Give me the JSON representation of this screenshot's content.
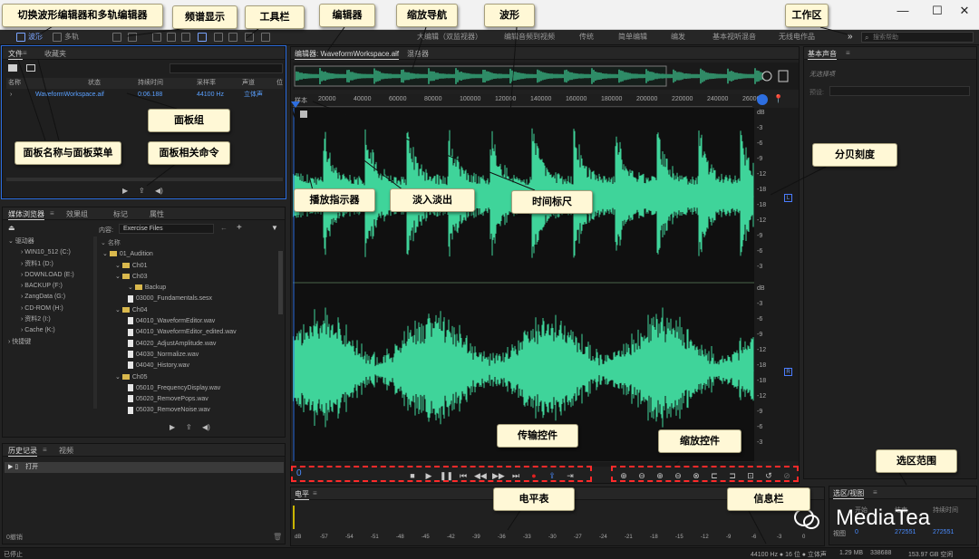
{
  "window": {
    "minimize": "—",
    "maximize": "☐",
    "close": "✕"
  },
  "toolbar": {
    "wave_label": "波形",
    "multitrack_label": "多轨",
    "workspace_items": [
      "大编辑（双监视器）",
      "编辑音频到视频",
      "传统",
      "简单编辑",
      "编发",
      "基本视听混音",
      "无线电作品"
    ],
    "more": "»",
    "search_placeholder": "搜索帮助"
  },
  "files_panel": {
    "tabs": [
      "文件",
      "收藏夹"
    ],
    "columns": [
      "名称",
      "状态",
      "持续时间",
      "采样率",
      "声道",
      "位"
    ],
    "file": {
      "name": "WaveformWorkspace.aif",
      "duration": "0:06.188",
      "rate": "44100 Hz",
      "channels": "立体声"
    }
  },
  "media_panel": {
    "tabs": [
      "媒体浏览器",
      "效果组",
      "标记",
      "属性"
    ],
    "content_label": "内容:",
    "content_value": "Exercise Files",
    "name_header": "名称",
    "drives_header": "驱动器",
    "drives": [
      "WIN10_512 (C:)",
      "资料1 (D:)",
      "DOWNLOAD (E:)",
      "BACKUP (F:)",
      "ZangData (G:)",
      "CD-ROM (H:)",
      "资料2 (I:)",
      "Cache (K:)"
    ],
    "shortcuts": "快捷键",
    "tree": [
      {
        "indent": 0,
        "type": "folder",
        "label": "01_Audition"
      },
      {
        "indent": 1,
        "type": "folder",
        "label": "Ch01"
      },
      {
        "indent": 1,
        "type": "folder",
        "label": "Ch03"
      },
      {
        "indent": 2,
        "type": "folder",
        "label": "Backup"
      },
      {
        "indent": 2,
        "type": "file",
        "label": "03000_Fundamentals.sesx"
      },
      {
        "indent": 1,
        "type": "folder",
        "label": "Ch04"
      },
      {
        "indent": 2,
        "type": "file",
        "label": "04010_WaveformEditor.wav"
      },
      {
        "indent": 2,
        "type": "file",
        "label": "04010_WaveformEditor_edited.wav"
      },
      {
        "indent": 2,
        "type": "file",
        "label": "04020_AdjustAmplitude.wav"
      },
      {
        "indent": 2,
        "type": "file",
        "label": "04030_Normalize.wav"
      },
      {
        "indent": 2,
        "type": "file",
        "label": "04040_History.wav"
      },
      {
        "indent": 1,
        "type": "folder",
        "label": "Ch05"
      },
      {
        "indent": 2,
        "type": "file",
        "label": "05010_FrequencyDisplay.wav"
      },
      {
        "indent": 2,
        "type": "file",
        "label": "05020_RemovePops.wav"
      },
      {
        "indent": 2,
        "type": "file",
        "label": "05030_RemoveNoise.wav"
      }
    ]
  },
  "history_panel": {
    "tabs": [
      "历史记录",
      "视频"
    ],
    "item": "打开",
    "footer": "0撤销"
  },
  "status_left": "已停止",
  "editor": {
    "tabs": [
      "编辑器: WaveformWorkspace.aif",
      "混音器"
    ],
    "ruler_unit": "样本",
    "ruler_labels": [
      "20000",
      "40000",
      "60000",
      "80000",
      "100000",
      "120000",
      "140000",
      "160000",
      "180000",
      "200000",
      "220000",
      "240000",
      "260000"
    ],
    "db_top": [
      "dB",
      "-3",
      "-6",
      "-9",
      "-12",
      "-18",
      "-18",
      "-12",
      "-9",
      "-6",
      "-3"
    ],
    "db_bottom": [
      "dB",
      "-3",
      "-6",
      "-9",
      "-12",
      "-18",
      "-18",
      "-12",
      "-9",
      "-6",
      "-3"
    ],
    "channel_l": "L",
    "channel_r": "R",
    "time_display": "0"
  },
  "essential_sound": {
    "title": "基本声音",
    "subtitle": "无选择项",
    "preset_label": "预设:"
  },
  "selection_panel": {
    "title": "选区/视图",
    "headers": [
      "开始",
      "结束",
      "持续时间"
    ],
    "view_label": "视图",
    "view_values": [
      "0",
      "272551",
      "272551"
    ]
  },
  "meter": {
    "title": "电平",
    "labels": [
      "dB",
      "-57",
      "-54",
      "-51",
      "-48",
      "-45",
      "-42",
      "-39",
      "-36",
      "-33",
      "-30",
      "-27",
      "-24",
      "-21",
      "-18",
      "-15",
      "-12",
      "-9",
      "-6",
      "-3",
      "0"
    ]
  },
  "info_bar": {
    "sample_info": "44100 Hz ● 16 位 ● 立体声",
    "size": "1.29 MB",
    "samples": "338688",
    "free": "153.97 GB 空闲"
  },
  "watermark": "MediaTea",
  "callouts": {
    "switch_editor": "切换波形编辑器和多轨编辑器",
    "spectrum": "频谱显示",
    "toolbar": "工具栏",
    "editor": "编辑器",
    "zoom_nav": "缩放导航",
    "waveform": "波形",
    "workspace": "工作区",
    "panel_group": "面板组",
    "panel_name_menu": "面板名称与面板菜单",
    "panel_commands": "面板相关命令",
    "playhead": "播放指示器",
    "fade": "淡入淡出",
    "time_ruler": "时间标尺",
    "db_scale": "分贝刻度",
    "transport": "传输控件",
    "zoom_ctrl": "缩放控件",
    "selection": "选区范围",
    "meter": "电平表",
    "info": "信息栏"
  },
  "colors": {
    "waveform": "#3fd49a",
    "accent": "#2d6ee0",
    "callout_bg": "#fff8d6",
    "dash": "#ff2a2a"
  }
}
